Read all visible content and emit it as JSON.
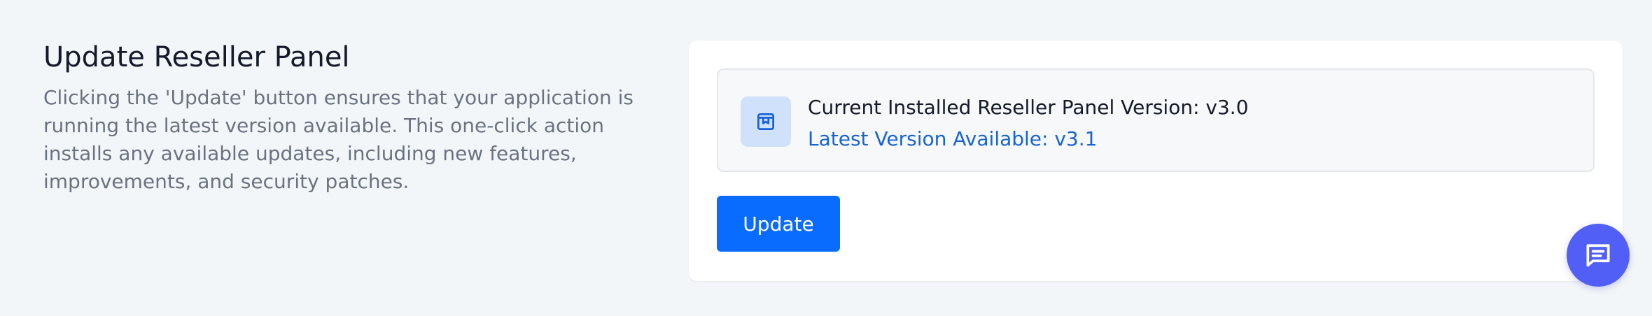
{
  "section": {
    "title": "Update Reseller Panel",
    "description": "Clicking the 'Update' button ensures that your application is running the latest version available. This one-click action installs any available updates, including new features, improvements, and security patches."
  },
  "version_info": {
    "current": "Current Installed Reseller Panel Version: v3.0",
    "latest": "Latest Version Available: v3.1",
    "icon": "archive-box-icon"
  },
  "actions": {
    "update_label": "Update"
  },
  "chat": {
    "icon": "chat-message-icon"
  },
  "colors": {
    "page_background": "#f3f6f9",
    "card_background": "#ffffff",
    "accent": "#0a6bff",
    "latest_version_text": "#1763d6",
    "chat_button": "#525ff7"
  }
}
